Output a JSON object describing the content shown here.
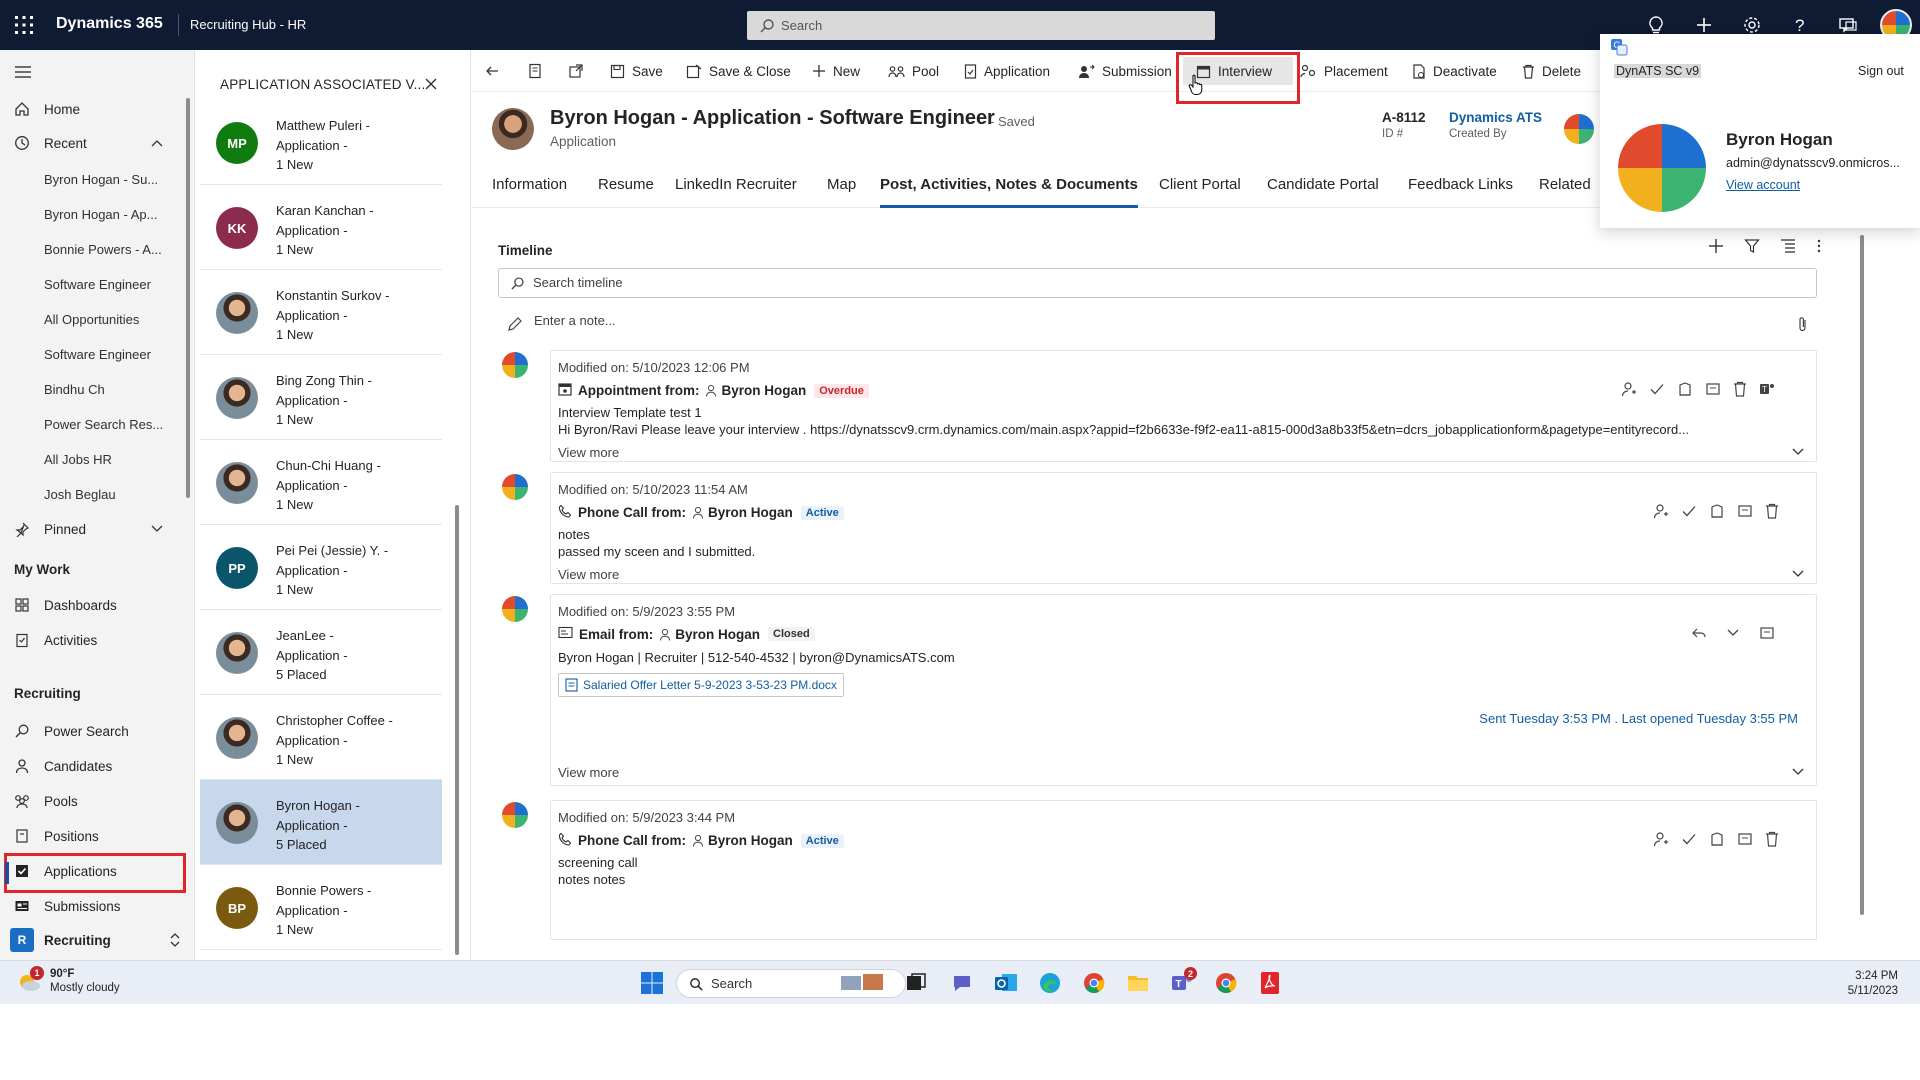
{
  "topbar": {
    "brand": "Dynamics 365",
    "app_name": "Recruiting Hub - HR",
    "search_placeholder": "Search",
    "icons": [
      "lightbulb-icon",
      "plus-icon",
      "gear-icon",
      "help-icon",
      "chat-icon",
      "avatar"
    ]
  },
  "leftnav": {
    "home": "Home",
    "recent": "Recent",
    "recent_items": [
      "Byron Hogan - Su...",
      "Byron Hogan - Ap...",
      "Bonnie Powers - A...",
      "Software Engineer",
      "All Opportunities",
      "Software Engineer",
      "Bindhu Ch",
      "Power Search Res...",
      "All Jobs HR",
      "Josh Beglau"
    ],
    "pinned": "Pinned",
    "my_work": "My Work",
    "dashboards": "Dashboards",
    "activities": "Activities",
    "recruiting": "Recruiting",
    "power_search": "Power Search",
    "candidates": "Candidates",
    "pools": "Pools",
    "positions": "Positions",
    "applications": "Applications",
    "submissions": "Submissions",
    "area": "Recruiting",
    "area_initial": "R"
  },
  "assoc": {
    "title": "APPLICATION ASSOCIATED V...",
    "records": [
      {
        "initials": "MP",
        "color": "#107c10",
        "photo": false,
        "line1": "Matthew Puleri -",
        "line2": "Application -",
        "line3": "1 New"
      },
      {
        "initials": "KK",
        "color": "#8b2c4f",
        "photo": false,
        "line1": "Karan Kanchan -",
        "line2": "Application -",
        "line3": "1 New"
      },
      {
        "initials": "",
        "color": "",
        "photo": true,
        "line1": "Konstantin Surkov -",
        "line2": "Application -",
        "line3": "1 New"
      },
      {
        "initials": "",
        "color": "",
        "photo": true,
        "line1": "Bing Zong Thin -",
        "line2": "Application -",
        "line3": "1 New"
      },
      {
        "initials": "",
        "color": "",
        "photo": true,
        "line1": "Chun-Chi Huang -",
        "line2": "Application -",
        "line3": "1 New"
      },
      {
        "initials": "PP",
        "color": "#0b556a",
        "photo": false,
        "line1": "Pei Pei (Jessie) Y. -",
        "line2": "Application -",
        "line3": "1 New"
      },
      {
        "initials": "",
        "color": "",
        "photo": true,
        "line1": "JeanLee -",
        "line2": "Application -",
        "line3": "5 Placed"
      },
      {
        "initials": "",
        "color": "",
        "photo": true,
        "line1": "Christopher Coffee -",
        "line2": "Application -",
        "line3": "1 New"
      },
      {
        "initials": "",
        "color": "",
        "photo": true,
        "line1": "Byron Hogan -",
        "line2": "Application -",
        "line3": "5 Placed",
        "selected": true
      },
      {
        "initials": "BP",
        "color": "#7a5a0e",
        "photo": false,
        "line1": "Bonnie Powers -",
        "line2": "Application -",
        "line3": "1 New"
      }
    ]
  },
  "commands": {
    "save": "Save",
    "save_close": "Save & Close",
    "new": "New",
    "pool": "Pool",
    "application": "Application",
    "submission": "Submission",
    "interview": "Interview",
    "placement": "Placement",
    "deactivate": "Deactivate",
    "delete": "Delete"
  },
  "record": {
    "title": "Byron Hogan - Application - Software Engineer",
    "saved": "- Saved",
    "entity": "Application",
    "id_value": "A-8112",
    "id_label": "ID #",
    "created_by_value": "Dynamics ATS",
    "created_by_label": "Created By"
  },
  "tabs": [
    "Information",
    "Resume",
    "LinkedIn Recruiter",
    "Map",
    "Post, Activities, Notes & Documents",
    "Client Portal",
    "Candidate Portal",
    "Feedback Links",
    "Related"
  ],
  "timeline": {
    "title": "Timeline",
    "search_placeholder": "Search timeline",
    "note_placeholder": "Enter a note...",
    "entries": [
      {
        "modified": "Modified on: 5/10/2023 12:06 PM",
        "type": "Appointment from:",
        "person": "Byron Hogan",
        "status": "Overdue",
        "line1": "Interview Template test 1",
        "line2": "Hi Byron/Ravi Please leave your interview .   https://dynatsscv9.crm.dynamics.com/main.aspx?appid=f2b6633e-f9f2-ea11-a815-000d3a8b33f5&etn=dcrs_jobapplicationform&pagetype=entityrecord...",
        "view_more": "View more"
      },
      {
        "modified": "Modified on: 5/10/2023 11:54 AM",
        "type": "Phone Call from:",
        "person": "Byron Hogan",
        "status": "Active",
        "line1": "notes",
        "line2": "passed my sceen and I submitted.",
        "view_more": "View more"
      },
      {
        "modified": "Modified on: 5/9/2023 3:55 PM",
        "type": "Email from:",
        "person": "Byron Hogan",
        "status": "Closed",
        "line1": "Byron Hogan | Recruiter | 512-540-4532 | byron@DynamicsATS.com",
        "attachment": "Salaried Offer Letter 5-9-2023 3-53-23 PM.docx",
        "sent_info": "Sent Tuesday 3:53 PM . Last opened Tuesday 3:55 PM",
        "view_more": "View more"
      },
      {
        "modified": "Modified on: 5/9/2023 3:44 PM",
        "type": "Phone Call from:",
        "person": "Byron Hogan",
        "status": "Active",
        "line1": "screening call",
        "line2": "notes notes"
      }
    ]
  },
  "profile": {
    "org": "DynATS SC v9",
    "sign_out": "Sign out",
    "name": "Byron Hogan",
    "email": "admin@dynatsscv9.onmicros...",
    "view_account": "View account"
  },
  "taskbar": {
    "temp": "90°F",
    "weather": "Mostly cloudy",
    "weather_badge": "1",
    "search": "Search",
    "time": "3:24 PM",
    "date": "5/11/2023",
    "teams_badge": "2"
  },
  "colors": {
    "topbar": "#0f1a33",
    "accent": "#115ea3",
    "highlight": "#e0252b",
    "selected_row": "#c7d7ec"
  }
}
